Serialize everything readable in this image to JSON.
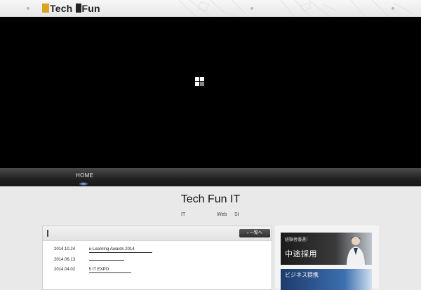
{
  "header": {
    "logo_text_1": "Tech ",
    "logo_text_2": "Fun"
  },
  "nav": {
    "home_label": "HOME"
  },
  "intro": {
    "title": "Tech Fun IT",
    "sub_1": "IT",
    "sub_2": "Web",
    "sub_3": "SI"
  },
  "news": {
    "more_label": "›  一覧へ",
    "items": [
      {
        "date": "2014.10.24",
        "title": "e-Learning Awards 2014"
      },
      {
        "date": "2014.06.13",
        "title": ""
      },
      {
        "date": "2014.04.02",
        "title": "5    IT       EXPO"
      }
    ]
  },
  "side": {
    "banner1_small": "経験者優遇！",
    "banner1_big": "中途採用",
    "banner2_big": "ビジネス提携"
  },
  "colors": {
    "accent": "#d9a520",
    "nav_bg": "#222222",
    "hero_bg": "#000000"
  }
}
